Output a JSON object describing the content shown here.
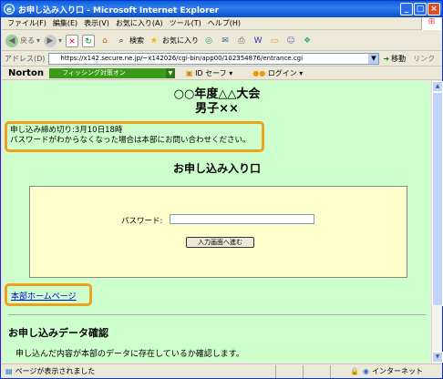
{
  "window": {
    "title": "お申し込み入り口 - Microsoft Internet Explorer",
    "minimize": "_",
    "maximize": "□",
    "close": "×"
  },
  "menu": [
    "ファイル(F)",
    "編集(E)",
    "表示(V)",
    "お気に入り(A)",
    "ツール(T)",
    "ヘルプ(H)"
  ],
  "toolbar": {
    "back": "戻る",
    "search": "検索",
    "favorites": "お気に入り"
  },
  "address": {
    "label": "アドレス(D)",
    "url": "https://x142.secure.ne.jp/~x142026/cgi-bin/app00/102354876/entrance.cgi",
    "go": "移動",
    "links": "リンク"
  },
  "norton": {
    "logo": "Norton",
    "phishing": "フィッシング対策オン",
    "idsafe": "ID セーフ",
    "login": "ログイン"
  },
  "page": {
    "title1": "○○年度△△大会",
    "title2": "男子××",
    "notice1": "申し込み締め切り:3月10日18時",
    "notice2": "パスワードがわからなくなった場合は本部にお問い合わせください。",
    "heading": "お申し込み入り口",
    "password_label": "パスワード:",
    "enter_button": "入力画面へ進む",
    "home_link": "本部ホームページ",
    "check_heading": "お申し込みデータ確認",
    "check_text": "申し込んだ内容が本部のデータに存在しているか確認します。"
  },
  "status": {
    "text": "ページが表示されました",
    "zone": "インターネット"
  }
}
